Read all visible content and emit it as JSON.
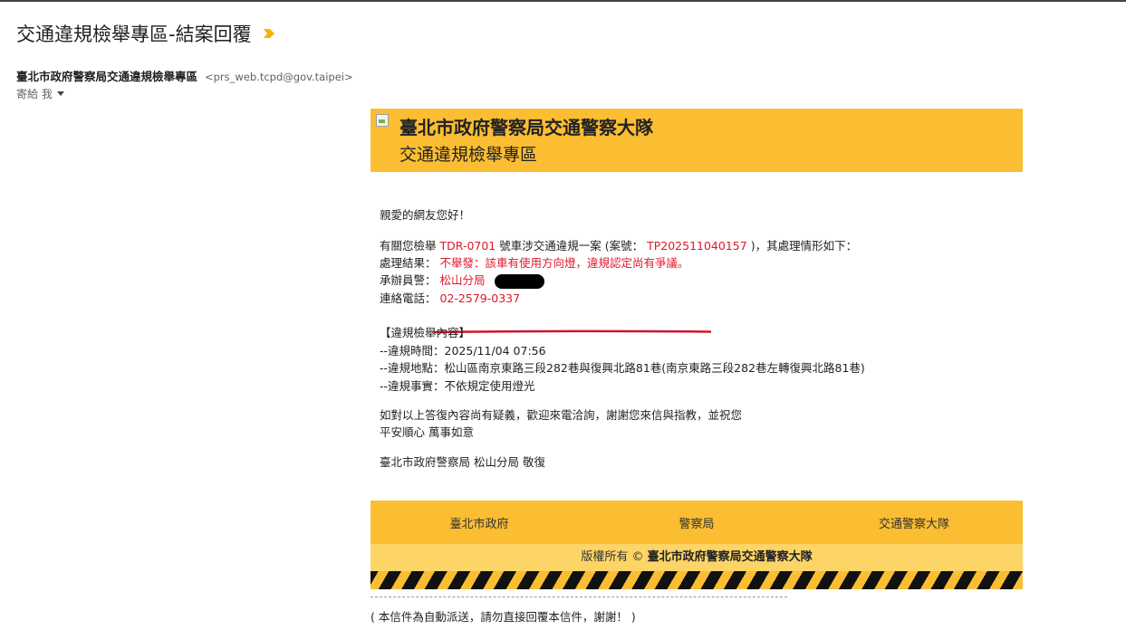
{
  "header": {
    "subject": "交通違規檢舉專區-結案回覆",
    "sender_name": "臺北市政府警察局交通違規檢舉專區",
    "sender_email": "<prs_web.tcpd@gov.taipei>",
    "to_label": "寄給 我"
  },
  "banner": {
    "title": "臺北市政府警察局交通警察大隊",
    "subtitle": "交通違規檢舉專區"
  },
  "body": {
    "greeting": "親愛的網友您好！",
    "intro_prefix": "有關您檢舉",
    "plate": "TDR-0701",
    "intro_mid": "號車涉交通違規一案 (案號：",
    "case_no": "TP202511040157",
    "intro_suffix": ")，其處理情形如下：",
    "result_label": "處理結果：",
    "result_value": "不舉發：該車有使用方向燈，違規認定尚有爭議。",
    "officer_label": "承辦員警：",
    "officer_value": "松山分局",
    "phone_label": "連絡電話：",
    "phone_value": "02-2579-0337",
    "section_title": "【違規檢舉內容】",
    "time_line": "--違規時間：2025/11/04 07:56",
    "place_line": "--違規地點：松山區南京東路三段282巷與復興北路81巷(南京東路三段282巷左轉復興北路81巷)",
    "fact_line": "--違規事實：不依規定使用燈光",
    "closing1": "如對以上答復內容尚有疑義，歡迎來電洽詢，謝謝您來信與指教，並祝您",
    "closing2": "平安順心 萬事如意",
    "signature": "臺北市政府警察局 松山分局 敬復"
  },
  "footer": {
    "links": [
      "臺北市政府",
      "警察局",
      "交通警察大隊"
    ],
    "copyright_prefix": "版權所有 ©",
    "copyright_org": "臺北市政府警察局交通警察大隊",
    "auto_note": "( 本信件為自動派送，請勿直接回覆本信件，謝謝！ )"
  },
  "colors": {
    "banner": "#fbbd32",
    "copyright_bg": "#fdd466",
    "highlight_red": "#e0162b",
    "important_marker": "#f4b400"
  }
}
